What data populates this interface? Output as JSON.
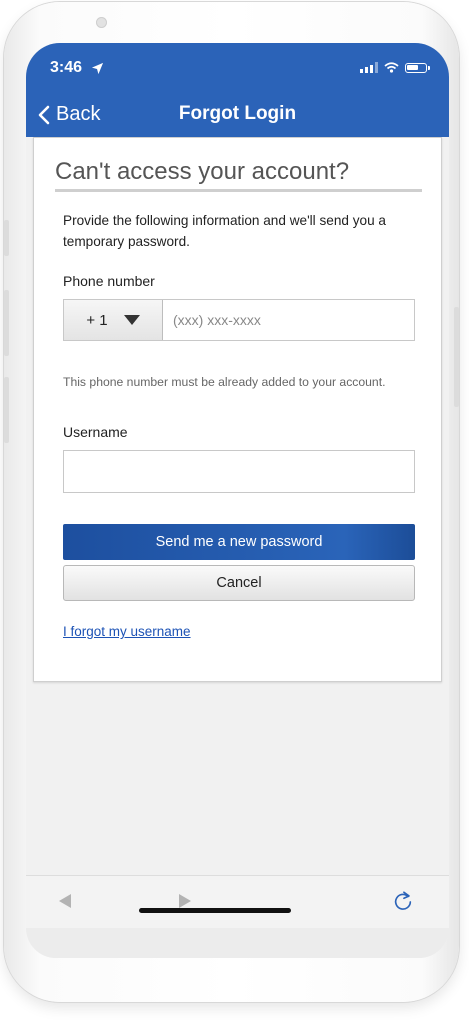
{
  "status_bar": {
    "time": "3:46"
  },
  "nav": {
    "back_label": "Back",
    "title": "Forgot Login"
  },
  "form": {
    "heading": "Can't access your account?",
    "description": "Provide the following information and we'll send you a temporary password.",
    "phone_label": "Phone number",
    "country_code": "+ 1",
    "phone_placeholder": "(xxx) xxx-xxxx",
    "phone_hint": "This phone number must be already added to your account.",
    "username_label": "Username",
    "username_value": "",
    "submit_label": "Send me a new password",
    "cancel_label": "Cancel",
    "forgot_username_link": "I forgot my username"
  },
  "colors": {
    "header_bg": "#2b63b8",
    "primary_button": "#2a64b9",
    "link": "#1c52b5"
  },
  "icons": [
    "location-arrow-icon",
    "signal-icon",
    "wifi-icon",
    "battery-icon",
    "chevron-left-icon",
    "caret-down-icon",
    "browser-back-icon",
    "browser-forward-icon",
    "reload-icon"
  ]
}
